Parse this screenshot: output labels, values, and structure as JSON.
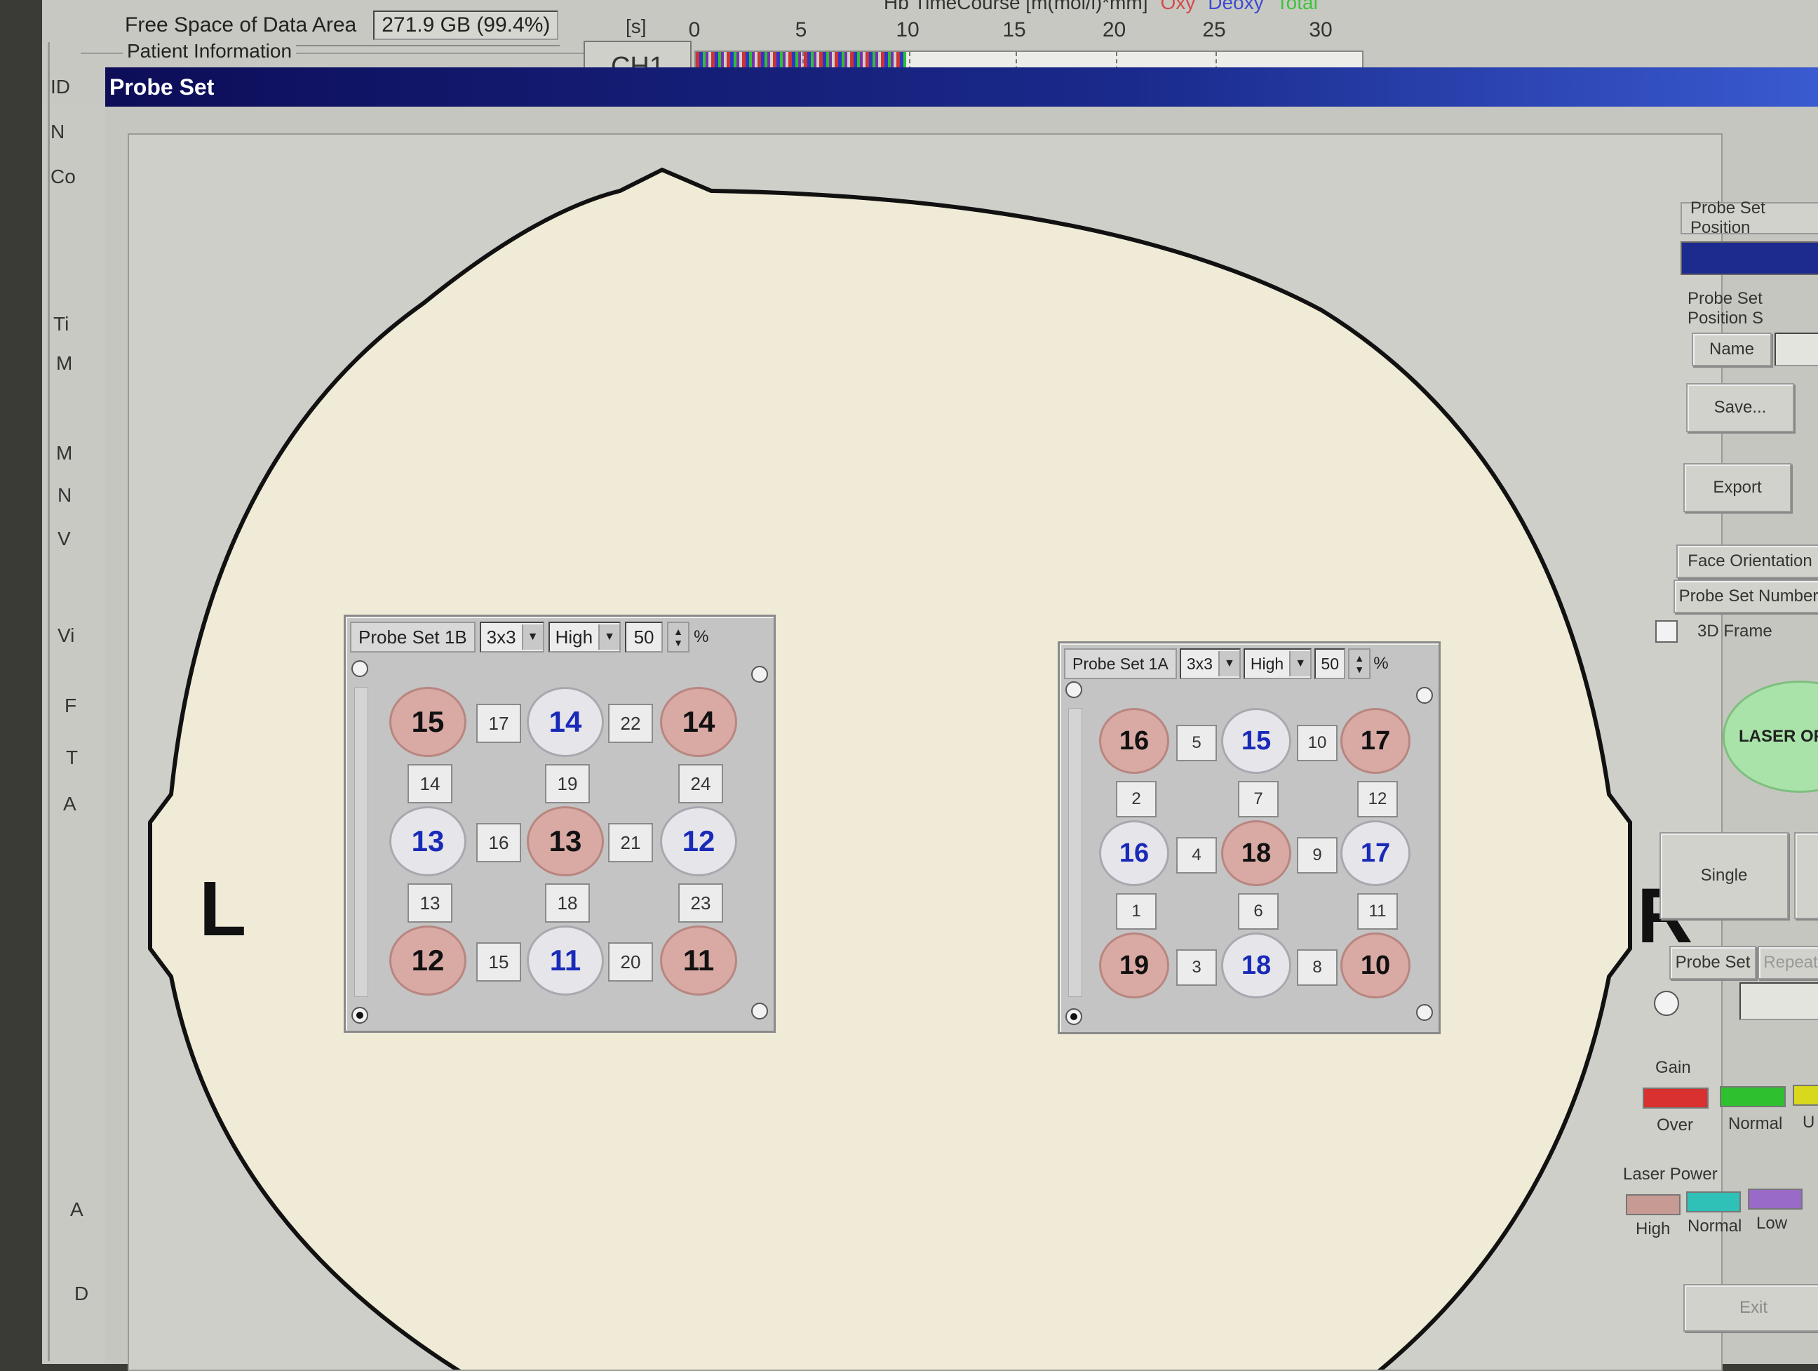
{
  "header": {
    "free_space_label": "Free Space of Data Area",
    "free_space_value": "271.9 GB",
    "free_space_pct": "(99.4%)",
    "patient_info_label": "Patient Information",
    "timecourse_label": "Hb TimeCourse [m(mol/l)*mm]",
    "timecourse_oxy": "Oxy",
    "timecourse_deoxy": "Deoxy",
    "timecourse_total": "Total",
    "seconds_label": "[s]",
    "channel": "CH1",
    "ticks": [
      "0",
      "5",
      "10",
      "15",
      "20",
      "25",
      "30"
    ]
  },
  "left_fragments": [
    "ID",
    "N",
    "Co",
    "Ti",
    "M",
    "M",
    "N",
    "V",
    "Vi",
    "F",
    "T",
    "A",
    "A",
    "D"
  ],
  "probe_window": {
    "title": "Probe Set",
    "left_label": "L",
    "right_label": "R"
  },
  "probe_1b": {
    "name": "Probe Set 1B",
    "mode": "3x3",
    "power": "High",
    "percent": "50",
    "percent_sign": "%",
    "optodes": [
      {
        "label": "15",
        "type": "src"
      },
      {
        "label": "14",
        "type": "det"
      },
      {
        "label": "14",
        "type": "src"
      },
      {
        "label": "13",
        "type": "det"
      },
      {
        "label": "13",
        "type": "src"
      },
      {
        "label": "12",
        "type": "det"
      },
      {
        "label": "12",
        "type": "src"
      },
      {
        "label": "11",
        "type": "det"
      },
      {
        "label": "11",
        "type": "src"
      }
    ],
    "h_channels": [
      "17",
      "22",
      "16",
      "21",
      "15",
      "20"
    ],
    "v_channels": [
      "14",
      "19",
      "24",
      "13",
      "18",
      "23"
    ]
  },
  "probe_1a": {
    "name": "Probe Set 1A",
    "mode": "3x3",
    "power": "High",
    "percent": "50",
    "percent_sign": "%",
    "optodes": [
      {
        "label": "16",
        "type": "src"
      },
      {
        "label": "15",
        "type": "det"
      },
      {
        "label": "17",
        "type": "src"
      },
      {
        "label": "16",
        "type": "det"
      },
      {
        "label": "18",
        "type": "src"
      },
      {
        "label": "17",
        "type": "det"
      },
      {
        "label": "19",
        "type": "src"
      },
      {
        "label": "18",
        "type": "det"
      },
      {
        "label": "10",
        "type": "src"
      }
    ],
    "h_channels": [
      "5",
      "10",
      "4",
      "9",
      "3",
      "8"
    ],
    "v_channels": [
      "2",
      "7",
      "12",
      "1",
      "6",
      "11"
    ]
  },
  "right_panel": {
    "probe_set_position": "Probe Set Position",
    "probe_set_position_s": "Probe Set Position S",
    "name_label": "Name",
    "save": "Save...",
    "export": "Export",
    "face_orientation": "Face Orientation",
    "probe_set_number": "Probe Set Number",
    "frame_3d": "3D Frame",
    "laser": "LASER OFF",
    "single": "Single",
    "probe_set": "Probe Set",
    "repeat": "Repeat",
    "gain_label": "Gain",
    "gain_over": "Over",
    "gain_normal": "Normal",
    "gain_under": "U",
    "laser_power_label": "Laser Power",
    "lp_high": "High",
    "lp_normal": "Normal",
    "lp_low": "Low",
    "exit": "Exit"
  },
  "colors": {
    "source": "#d9a9a3",
    "detector": "#e6e6ea",
    "detector_text": "#1a2ab8",
    "gain_over": "#d93030",
    "gain_normal": "#2fc02f",
    "gain_under": "#d8d81c",
    "lp_high": "#c89a94",
    "lp_normal": "#2fc0b8",
    "lp_low": "#9a6ac8"
  }
}
